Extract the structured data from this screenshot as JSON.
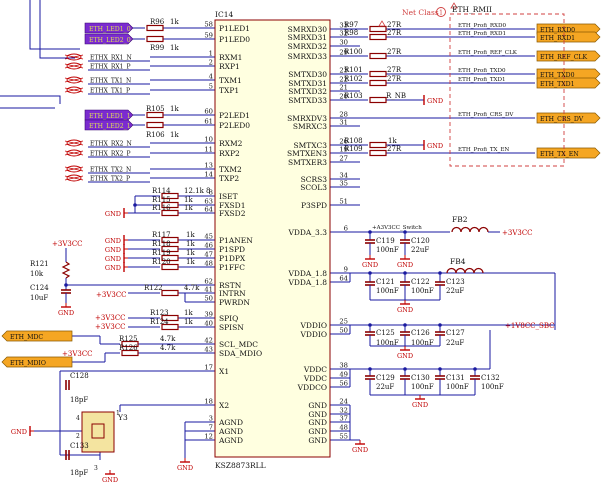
{
  "colors": {
    "wire": "#1a1aa0",
    "part": "#8b0000",
    "ic_fill": "#ffffe0",
    "label_fill": "#f5a623",
    "label_left_fill": "#7b2bd0",
    "gnd": "#c00000",
    "netclass": "#d04040"
  },
  "ic": {
    "designator": "IC14",
    "part_name": "KSZ8873RLL",
    "left_pins": [
      {
        "num": "58",
        "name": "P1LED1"
      },
      {
        "num": "59",
        "name": "P1LED0"
      },
      {
        "num": "1",
        "name": "RXM1"
      },
      {
        "num": "2",
        "name": "RXP1"
      },
      {
        "num": "4",
        "name": "TXM1"
      },
      {
        "num": "5",
        "name": "TXP1"
      },
      {
        "num": "60",
        "name": "P2LED1"
      },
      {
        "num": "61",
        "name": "P2LED0"
      },
      {
        "num": "10",
        "name": "RXM2"
      },
      {
        "num": "11",
        "name": "RXP2"
      },
      {
        "num": "13",
        "name": "TXM2"
      },
      {
        "num": "14",
        "name": "TXP2"
      },
      {
        "num": "8",
        "name": "ISET"
      },
      {
        "num": "63",
        "name": "FXSD1"
      },
      {
        "num": "64",
        "name": "FXSD2"
      },
      {
        "num": "45",
        "name": "P1ANEN"
      },
      {
        "num": "46",
        "name": "P1SPD"
      },
      {
        "num": "47",
        "name": "P1DPX"
      },
      {
        "num": "48",
        "name": "P1FFC"
      },
      {
        "num": "62",
        "name": "RSTN"
      },
      {
        "num": "41",
        "name": "INTRN"
      },
      {
        "num": "50",
        "name": "PWRDN"
      },
      {
        "num": "39",
        "name": "SPIQ"
      },
      {
        "num": "40",
        "name": "SPISN"
      },
      {
        "num": "42",
        "name": "SCL_MDC"
      },
      {
        "num": "43",
        "name": "SDA_MDIO"
      },
      {
        "num": "17",
        "name": "X1"
      },
      {
        "num": "18",
        "name": "X2"
      },
      {
        "num": "3",
        "name": "AGND"
      },
      {
        "num": "7",
        "name": "AGND"
      },
      {
        "num": "12",
        "name": "AGND"
      }
    ],
    "right_pins": [
      {
        "num": "33",
        "name": "SMRXD30"
      },
      {
        "num": "32",
        "name": "SMRXD31"
      },
      {
        "num": "30",
        "name": "SMRXD32"
      },
      {
        "num": "29",
        "name": "SMRXD33"
      },
      {
        "num": "23",
        "name": "SMTXD30"
      },
      {
        "num": "22",
        "name": "SMTXD31"
      },
      {
        "num": "21",
        "name": "SMTXD32"
      },
      {
        "num": "20",
        "name": "SMTXD33"
      },
      {
        "num": "28",
        "name": "SMRXDV3"
      },
      {
        "num": "31",
        "name": "SMRXC3"
      },
      {
        "num": "26",
        "name": "SMTXC3"
      },
      {
        "num": "19",
        "name": "SMTXEN3"
      },
      {
        "num": "27",
        "name": "SMTXER3"
      },
      {
        "num": "34",
        "name": "SCRS3"
      },
      {
        "num": "35",
        "name": "SCOL3"
      },
      {
        "num": "51",
        "name": "P3SPD"
      },
      {
        "num": "6",
        "name": "VDDA_3.3"
      },
      {
        "num": "9",
        "name": "VDDA_1.8"
      },
      {
        "num": "64",
        "name": "VDDA_1.8"
      },
      {
        "num": "25",
        "name": "VDDIO"
      },
      {
        "num": "50",
        "name": "VDDIO"
      },
      {
        "num": "38",
        "name": "VDDC"
      },
      {
        "num": "49",
        "name": "VDDC"
      },
      {
        "num": "56",
        "name": "VDDCO"
      },
      {
        "num": "24",
        "name": "GND"
      },
      {
        "num": "32",
        "name": "GND"
      },
      {
        "num": "37",
        "name": "GND"
      },
      {
        "num": "48",
        "name": "GND"
      },
      {
        "num": "55",
        "name": "GND"
      }
    ]
  },
  "left_labels": [
    {
      "text": "ETH_LED1_0",
      "kind": "label"
    },
    {
      "text": "ETH_LED2_0",
      "kind": "label"
    },
    {
      "text": "ETHX_RX1_N",
      "kind": "diff"
    },
    {
      "text": "ETHX_RX1_P",
      "kind": "diff"
    },
    {
      "text": "ETHX_TX1_N",
      "kind": "diff"
    },
    {
      "text": "ETHX_TX1_P",
      "kind": "diff"
    },
    {
      "text": "ETH_LED1_1",
      "kind": "label"
    },
    {
      "text": "ETH_LED2_1",
      "kind": "label"
    },
    {
      "text": "ETHX_RX2_N",
      "kind": "diff"
    },
    {
      "text": "ETHX_RX2_P",
      "kind": "diff"
    },
    {
      "text": "ETHX_TX2_N",
      "kind": "diff"
    },
    {
      "text": "ETHX_TX2_P",
      "kind": "diff"
    }
  ],
  "left_resistors": [
    {
      "ref": "R96",
      "val": "1k"
    },
    {
      "ref": "R99",
      "val": "1k"
    },
    {
      "ref": "R105",
      "val": "1k"
    },
    {
      "ref": "R106",
      "val": "1k"
    },
    {
      "ref": "R114",
      "val": "12.1k 8"
    },
    {
      "ref": "R115",
      "val": "1k"
    },
    {
      "ref": "R116",
      "val": "1k"
    },
    {
      "ref": "R117",
      "val": "1k"
    },
    {
      "ref": "R118",
      "val": "1k"
    },
    {
      "ref": "R119",
      "val": "1k"
    },
    {
      "ref": "R120",
      "val": "1k"
    },
    {
      "ref": "R122",
      "val": "4.7k"
    },
    {
      "ref": "R123",
      "val": "1k"
    },
    {
      "ref": "R124",
      "val": "1k"
    },
    {
      "ref": "R125",
      "val": "4.7k"
    },
    {
      "ref": "R126",
      "val": "4.7k"
    }
  ],
  "right_resistors": [
    {
      "ref": "R97",
      "val": "27R"
    },
    {
      "ref": "R98",
      "val": "27R"
    },
    {
      "ref": "R100",
      "val": "27R"
    },
    {
      "ref": "R101",
      "val": "27R"
    },
    {
      "ref": "R102",
      "val": "27R"
    },
    {
      "ref": "R103",
      "val": "R_NB"
    },
    {
      "ref": "R108",
      "val": "1k"
    },
    {
      "ref": "R109",
      "val": "27R"
    }
  ],
  "right_nets": [
    "ETH_Profi_RXD0",
    "ETH_Profi_RXD1",
    "ETH_Profi_REF_CLK",
    "ETH_Profi_TXD0",
    "ETH_Profi_TXD1",
    "ETH_Profi_CRS_DV",
    "ETH_Profi_TX_EN"
  ],
  "right_ports": [
    "ETH_RXD0",
    "ETH_RXD1",
    "ETH_REF_CLK",
    "ETH_TXD0",
    "ETH_TXD1",
    "ETH_CRS_DV",
    "ETH_TX_EN"
  ],
  "net_class": {
    "label": "Net Class",
    "name": "ETH_RMII",
    "mark": "1"
  },
  "supplies": {
    "v33": "+3V3CC",
    "v18": "+1V8CC_SBC",
    "a33_switch": "+A3V3CC_Switch",
    "gnd": "GND"
  },
  "caps_power": [
    {
      "ref": "C119",
      "val": "100nF"
    },
    {
      "ref": "C120",
      "val": "22uF"
    },
    {
      "ref": "C121",
      "val": "100nF"
    },
    {
      "ref": "C122",
      "val": "100nF"
    },
    {
      "ref": "C123",
      "val": "22uF"
    },
    {
      "ref": "C125",
      "val": "100nF"
    },
    {
      "ref": "C126",
      "val": "100nF"
    },
    {
      "ref": "C127",
      "val": "22uF"
    },
    {
      "ref": "C129",
      "val": "22uF"
    },
    {
      "ref": "C130",
      "val": "100nF"
    },
    {
      "ref": "C131",
      "val": "100nF"
    },
    {
      "ref": "C132",
      "val": "100nF"
    }
  ],
  "ferrites": [
    "FB2",
    "FB4"
  ],
  "misc": {
    "r121_ref": "R121",
    "r121_val": "10k",
    "c124_ref": "C124",
    "c124_val": "10uF",
    "c128_ref": "C128",
    "c128_val": "18pF",
    "c133_ref": "C133",
    "c133_val": "18pF",
    "crystal": "Y3",
    "mdc": "ETH_MDC",
    "mdio": "ETH_MDIO",
    "xtal_pins": [
      "1",
      "2",
      "3",
      "4"
    ]
  }
}
